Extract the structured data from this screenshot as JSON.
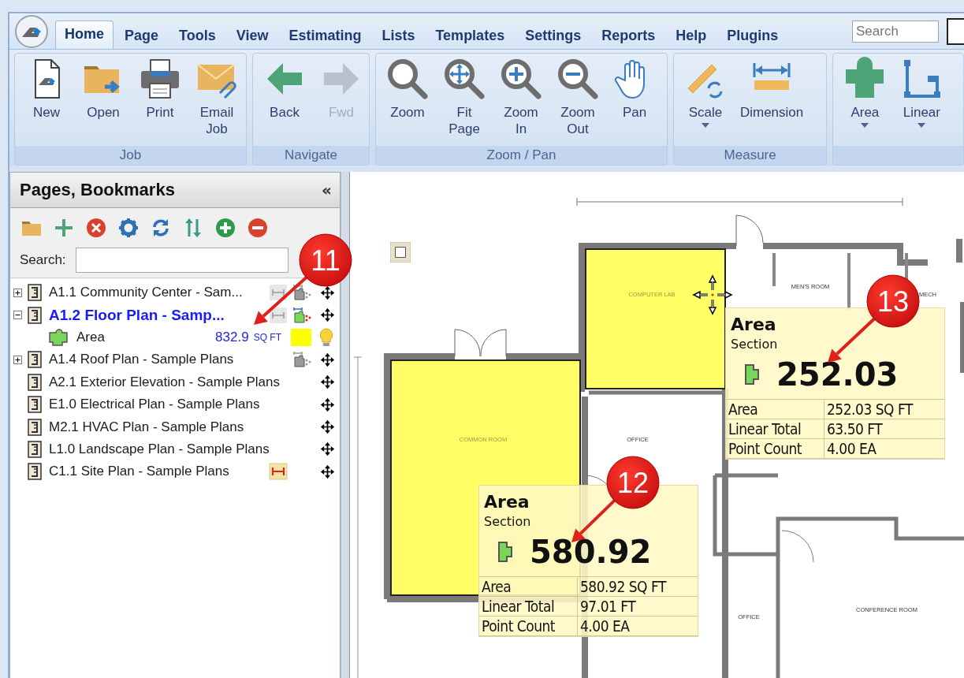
{
  "app": {
    "tabs": [
      {
        "label": "Home",
        "selected": true
      },
      {
        "label": "Page",
        "selected": false
      },
      {
        "label": "Tools",
        "selected": false
      },
      {
        "label": "View",
        "selected": false
      },
      {
        "label": "Estimating",
        "selected": false
      },
      {
        "label": "Lists",
        "selected": false
      },
      {
        "label": "Templates",
        "selected": false
      },
      {
        "label": "Settings",
        "selected": false
      },
      {
        "label": "Reports",
        "selected": false
      },
      {
        "label": "Help",
        "selected": false
      },
      {
        "label": "Plugins",
        "selected": false
      }
    ],
    "search": {
      "placeholder": "Search"
    }
  },
  "ribbon": {
    "groups": [
      {
        "label": "Job",
        "buttons": [
          {
            "kind": "new",
            "label": "New",
            "disabled": false,
            "dropdown": false
          },
          {
            "kind": "open",
            "label": "Open",
            "disabled": false,
            "dropdown": false
          },
          {
            "kind": "print",
            "label": "Print",
            "disabled": false,
            "dropdown": false
          },
          {
            "kind": "email",
            "label": "Email\nJob",
            "disabled": false,
            "dropdown": false
          }
        ]
      },
      {
        "label": "Navigate",
        "buttons": [
          {
            "kind": "back",
            "label": "Back",
            "disabled": false,
            "dropdown": false
          },
          {
            "kind": "fwd",
            "label": "Fwd",
            "disabled": true,
            "dropdown": false
          }
        ]
      },
      {
        "label": "Zoom / Pan",
        "buttons": [
          {
            "kind": "zoom",
            "label": "Zoom",
            "disabled": false,
            "dropdown": false
          },
          {
            "kind": "fit",
            "label": "Fit\nPage",
            "disabled": false,
            "dropdown": false
          },
          {
            "kind": "zoomin",
            "label": "Zoom\nIn",
            "disabled": false,
            "dropdown": false
          },
          {
            "kind": "zoomout",
            "label": "Zoom\nOut",
            "disabled": false,
            "dropdown": false
          },
          {
            "kind": "pan",
            "label": "Pan",
            "disabled": false,
            "dropdown": false
          }
        ]
      },
      {
        "label": "Measure",
        "buttons": [
          {
            "kind": "scale",
            "label": "Scale",
            "disabled": false,
            "dropdown": true
          },
          {
            "kind": "dimension",
            "label": "Dimension",
            "disabled": false,
            "dropdown": false
          }
        ]
      },
      {
        "buttons": [
          {
            "kind": "area",
            "label": "Area",
            "disabled": false,
            "dropdown": true
          },
          {
            "kind": "linear",
            "label": "Linear",
            "disabled": false,
            "dropdown": true
          }
        ]
      }
    ]
  },
  "pages_panel": {
    "title": "Pages, Bookmarks",
    "collapse": "«",
    "search_label": "Search:",
    "tree": [
      {
        "label": "A1.1 Community Center - Sam...",
        "expandable": true,
        "expanded": false,
        "selected": false,
        "markers": [
          {
            "kind": "dimension",
            "active": false
          },
          {
            "kind": "area",
            "active": false
          }
        ]
      },
      {
        "label": "A1.2 Floor Plan - Samp...",
        "expandable": true,
        "expanded": true,
        "selected": true,
        "markers": [
          {
            "kind": "dimension",
            "active": false
          },
          {
            "kind": "area",
            "active": true
          }
        ],
        "children": [
          {
            "kind": "measure",
            "label": "Area",
            "value": "832.9",
            "unit": "SQ FT",
            "color": "#ffff00"
          }
        ]
      },
      {
        "label": "A1.4 Roof Plan - Sample Plans",
        "expandable": true,
        "expanded": false,
        "selected": false,
        "markers": [
          {
            "kind": "area",
            "active": false
          }
        ]
      },
      {
        "label": "A2.1 Exterior Elevation - Sample Plans",
        "expandable": false,
        "selected": false
      },
      {
        "label": "E1.0 Electrical Plan - Sample Plans",
        "expandable": false,
        "selected": false
      },
      {
        "label": "M2.1 HVAC Plan - Sample Plans",
        "expandable": false,
        "selected": false
      },
      {
        "label": "L1.0 Landscape Plan - Sample Plans",
        "expandable": false,
        "selected": false
      },
      {
        "label": "C1.1 Site Plan - Sample Plans",
        "expandable": false,
        "selected": false,
        "markers": [
          {
            "kind": "dimension",
            "active": true
          }
        ]
      }
    ]
  },
  "canvas": {
    "checkbox": {
      "checked": false
    },
    "rooms": [
      "COMPUTER LAB",
      "MEN'S ROOM",
      "MECH",
      "COMMON ROOM",
      "OFFICE",
      "OFFICE",
      "CONFERENCE ROOM"
    ],
    "tooltips": [
      {
        "title": "Area",
        "subtitle": "Section",
        "value": "252.03",
        "rows": [
          {
            "label": "Area",
            "value": "252.03 SQ FT"
          },
          {
            "label": "Linear Total",
            "value": "63.50 FT"
          },
          {
            "label": "Point Count",
            "value": "4.00 EA"
          }
        ]
      },
      {
        "title": "Area",
        "subtitle": "Section",
        "value": "580.92",
        "rows": [
          {
            "label": "Area",
            "value": "580.92 SQ FT"
          },
          {
            "label": "Linear Total",
            "value": "97.01 FT"
          },
          {
            "label": "Point Count",
            "value": "4.00 EA"
          }
        ]
      }
    ]
  },
  "callouts": [
    "11",
    "13",
    "12"
  ]
}
